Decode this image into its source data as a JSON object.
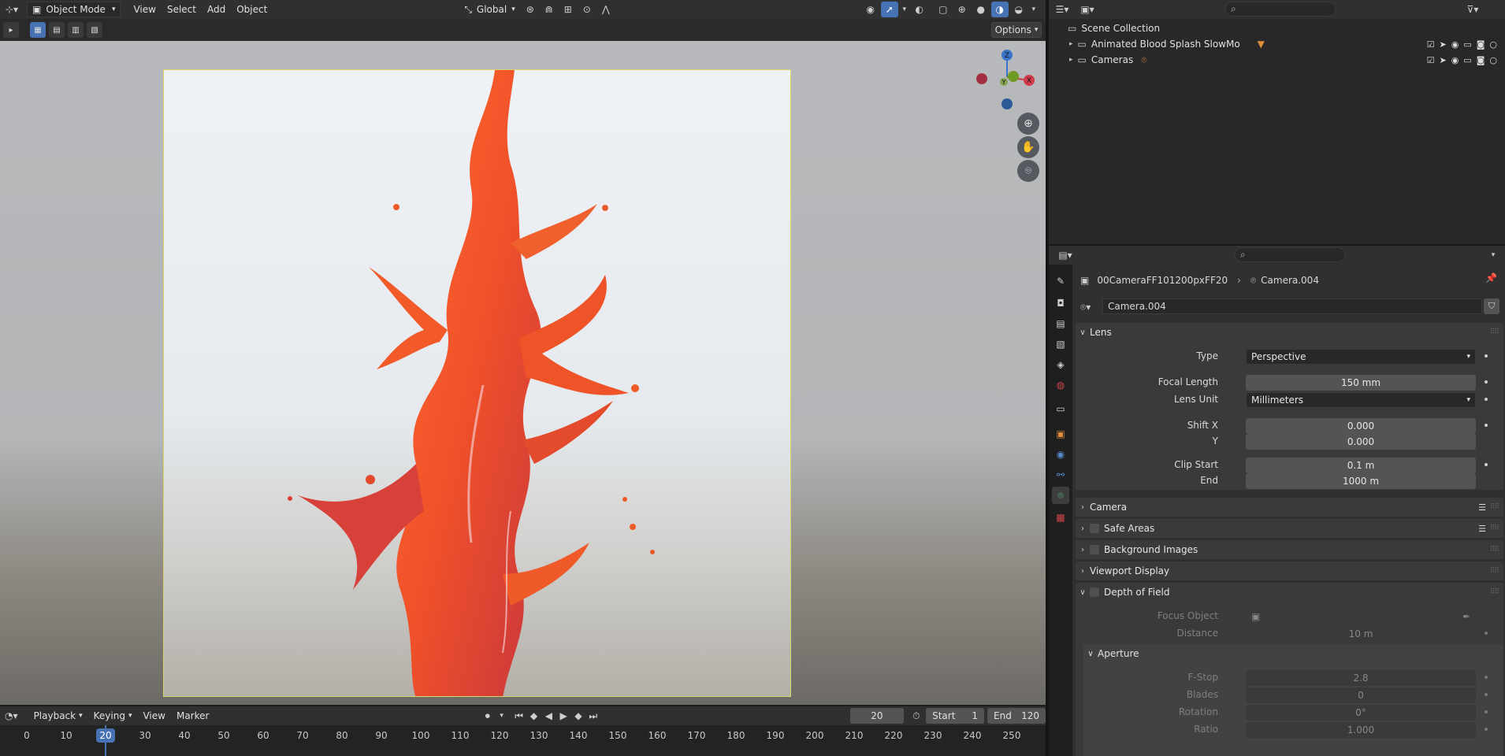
{
  "viewport_header": {
    "mode": "Object Mode",
    "menus": [
      "View",
      "Select",
      "Add",
      "Object"
    ],
    "transform_orientation": "Global"
  },
  "options_label": "Options",
  "gizmo": {
    "x": "X",
    "y": "Y",
    "z": "Z"
  },
  "timeline": {
    "menus": [
      "Playback",
      "Keying",
      "View",
      "Marker"
    ],
    "current_frame": "20",
    "start_label": "Start",
    "start_value": "1",
    "end_label": "End",
    "end_value": "120",
    "ticks": [
      "0",
      "10",
      "20",
      "30",
      "40",
      "50",
      "60",
      "70",
      "80",
      "90",
      "100",
      "110",
      "120",
      "130",
      "140",
      "150",
      "160",
      "170",
      "180",
      "190",
      "200",
      "210",
      "220",
      "230",
      "240",
      "250"
    ],
    "playhead": "20"
  },
  "outliner": {
    "root": "Scene Collection",
    "items": [
      {
        "label": "Animated Blood Splash SlowMo"
      },
      {
        "label": "Cameras"
      }
    ]
  },
  "properties": {
    "breadcrumb_object": "00CameraFF101200pxFF20",
    "breadcrumb_data": "Camera.004",
    "datablock_name": "Camera.004",
    "lens_panel": "Lens",
    "type_label": "Type",
    "type_value": "Perspective",
    "focal_label": "Focal Length",
    "focal_value": "150 mm",
    "lens_unit_label": "Lens Unit",
    "lens_unit_value": "Millimeters",
    "shiftx_label": "Shift X",
    "shiftx_value": "0.000",
    "shifty_label": "Y",
    "shifty_value": "0.000",
    "clip_start_label": "Clip Start",
    "clip_start_value": "0.1 m",
    "clip_end_label": "End",
    "clip_end_value": "1000 m",
    "panels": {
      "camera": "Camera",
      "safe_areas": "Safe Areas",
      "background_images": "Background Images",
      "viewport_display": "Viewport Display",
      "depth_of_field": "Depth of Field"
    },
    "focus_object_label": "Focus Object",
    "distance_label": "Distance",
    "distance_value": "10 m",
    "aperture_panel": "Aperture",
    "fstop_label": "F-Stop",
    "fstop_value": "2.8",
    "blades_label": "Blades",
    "blades_value": "0",
    "rotation_label": "Rotation",
    "rotation_value": "0°",
    "ratio_label": "Ratio",
    "ratio_value": "1.000"
  },
  "colors": {
    "accent": "#4772b3",
    "camera_frame": "#d6d36a",
    "splash": "#f05a28",
    "axis_x": "#d23b4a",
    "axis_y": "#6f9a24",
    "axis_z": "#3a74c8"
  }
}
